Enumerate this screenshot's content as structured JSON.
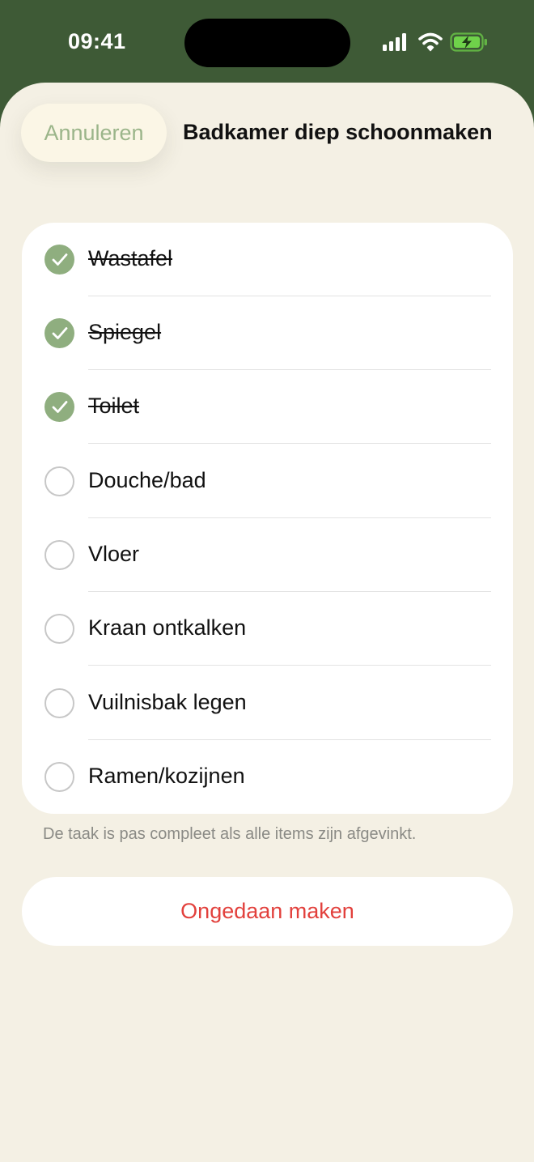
{
  "status_bar": {
    "time": "09:41",
    "icons": [
      "cellular-signal-icon",
      "wifi-icon",
      "battery-charging-icon"
    ],
    "battery_color": "#6fd24a"
  },
  "header": {
    "cancel_label": "Annuleren",
    "title": "Badkamer diep schoonmaken"
  },
  "checklist": {
    "items": [
      {
        "label": "Wastafel",
        "checked": true
      },
      {
        "label": "Spiegel",
        "checked": true
      },
      {
        "label": "Toilet",
        "checked": true
      },
      {
        "label": "Douche/bad",
        "checked": false
      },
      {
        "label": "Vloer",
        "checked": false
      },
      {
        "label": "Kraan ontkalken",
        "checked": false
      },
      {
        "label": "Vuilnisbak legen",
        "checked": false
      },
      {
        "label": "Ramen/kozijnen",
        "checked": false
      }
    ],
    "footnote": "De taak is pas compleet als alle items zijn afgevinkt."
  },
  "actions": {
    "undo_label": "Ongedaan maken"
  },
  "colors": {
    "header_green": "#3e5a36",
    "sheet_background": "#f4f0e4",
    "accent_green": "#8fae7f",
    "destructive_red": "#e2403c"
  }
}
